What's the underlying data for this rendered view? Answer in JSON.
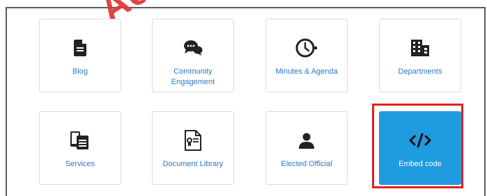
{
  "watermark": "Ac",
  "tiles": [
    {
      "label": "Blog",
      "icon": "document-icon"
    },
    {
      "label": "Community Engagement",
      "icon": "chat-bubbles-icon"
    },
    {
      "label": "Minutes & Agenda",
      "icon": "clock-icon"
    },
    {
      "label": "Departments",
      "icon": "building-icon"
    },
    {
      "label": "Services",
      "icon": "devices-icon"
    },
    {
      "label": "Document Library",
      "icon": "certificate-icon"
    },
    {
      "label": "Elected Official",
      "icon": "person-icon"
    },
    {
      "label": "Embed code",
      "icon": "code-icon",
      "selected": true
    }
  ],
  "colors": {
    "tile_label": "#2a78c8",
    "active_tile": "#1f9be0",
    "highlight": "#e41f1f",
    "icon": "#222222"
  }
}
